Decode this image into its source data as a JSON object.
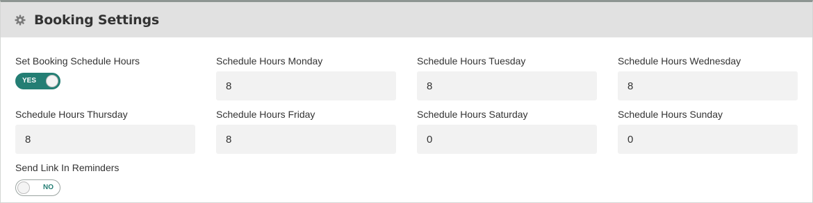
{
  "header": {
    "icon": "gear-icon",
    "title": "Booking Settings"
  },
  "fields": {
    "schedule_toggle": {
      "label": "Set Booking Schedule Hours",
      "state_text": "YES",
      "on": true
    },
    "monday": {
      "label": "Schedule Hours Monday",
      "value": "8"
    },
    "tuesday": {
      "label": "Schedule Hours Tuesday",
      "value": "8"
    },
    "wednesday": {
      "label": "Schedule Hours Wednesday",
      "value": "8"
    },
    "thursday": {
      "label": "Schedule Hours Thursday",
      "value": "8"
    },
    "friday": {
      "label": "Schedule Hours Friday",
      "value": "8"
    },
    "saturday": {
      "label": "Schedule Hours Saturday",
      "value": "0"
    },
    "sunday": {
      "label": "Schedule Hours Sunday",
      "value": "0"
    },
    "reminders_toggle": {
      "label": "Send Link In Reminders",
      "state_text": "NO",
      "on": false
    }
  },
  "colors": {
    "accent": "#247e74",
    "header_bg": "#e1e1e1",
    "input_bg": "#f2f2f2"
  }
}
